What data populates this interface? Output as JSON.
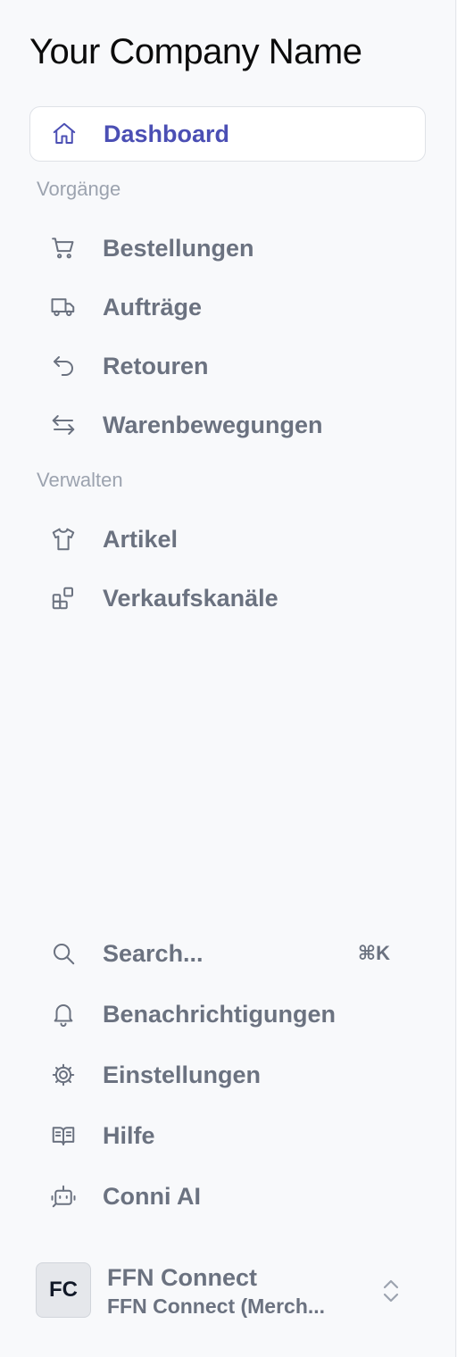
{
  "company": {
    "name": "Your Company Name"
  },
  "nav": {
    "dashboard": "Dashboard",
    "section_vorgaenge": "Vorgänge",
    "items_vorgaenge": [
      "Bestellungen",
      "Aufträge",
      "Retouren",
      "Warenbewegungen"
    ],
    "section_verwalten": "Verwalten",
    "items_verwalten": [
      "Artikel",
      "Verkaufskanäle"
    ]
  },
  "bottom": {
    "search": "Search...",
    "search_shortcut": "⌘K",
    "notifications": "Benachrichtigungen",
    "settings": "Einstellungen",
    "help": "Hilfe",
    "ai": "Conni AI"
  },
  "profile": {
    "initials": "FC",
    "name": "FFN Connect",
    "org": "FFN Connect (Merch..."
  },
  "icons": {
    "dashboard": "home-icon",
    "bestellungen": "cart-icon",
    "auftraege": "truck-icon",
    "retouren": "return-arrow-icon",
    "warenbewegungen": "arrows-swap-icon",
    "artikel": "shirt-icon",
    "verkaufskanaele": "squares-plus-icon",
    "search": "search-icon",
    "notifications": "bell-icon",
    "settings": "gear-icon",
    "help": "book-icon",
    "ai": "robot-icon",
    "profile_switch": "chevron-up-down-icon"
  },
  "colors": {
    "accent": "#4b4fb4",
    "text": "#6b7280",
    "section": "#9ca3af",
    "background": "#f8f9fb"
  }
}
